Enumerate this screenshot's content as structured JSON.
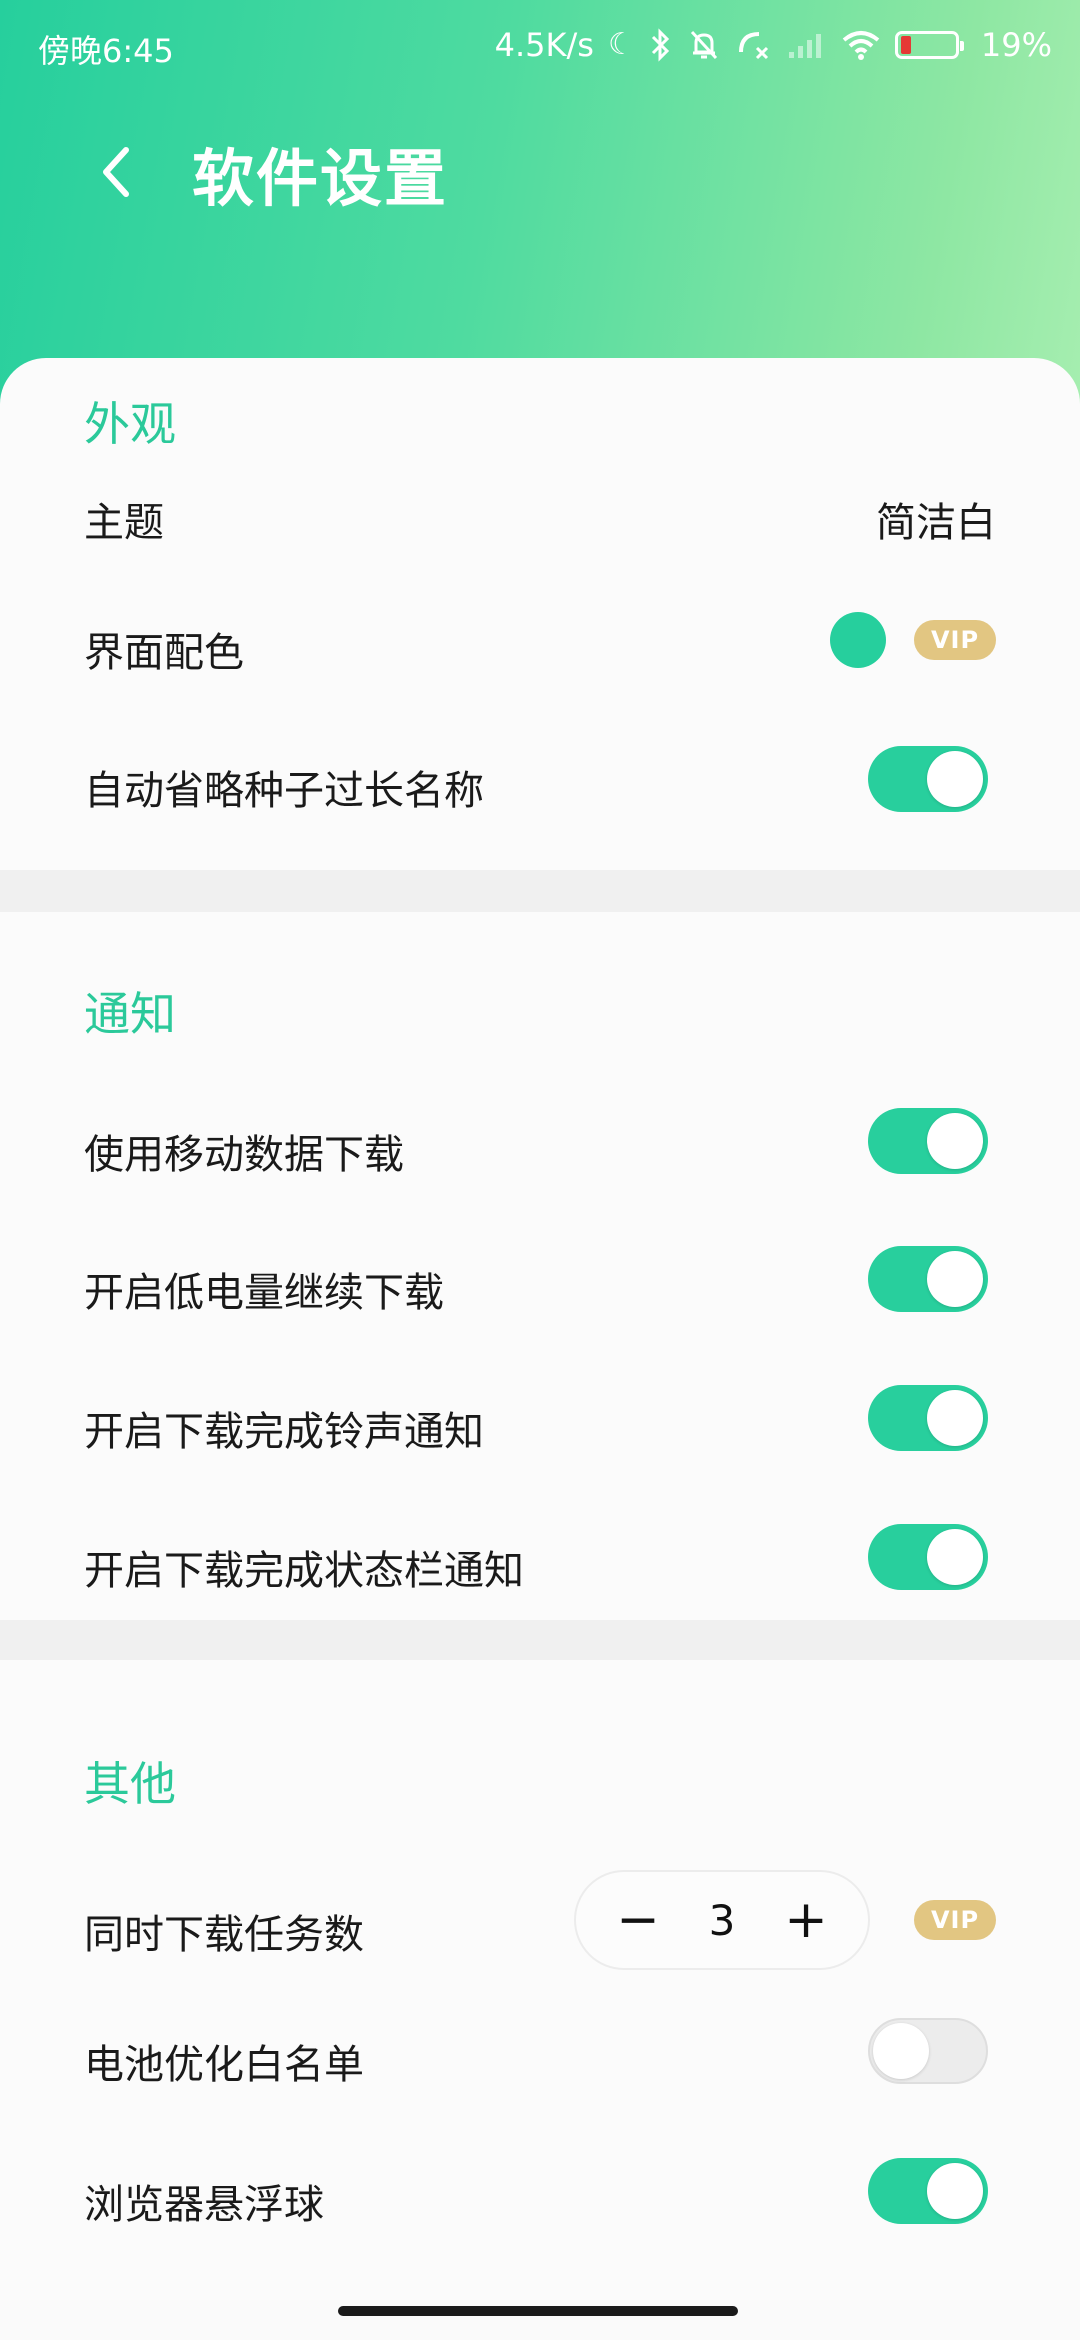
{
  "status": {
    "time": "傍晚6:45",
    "speed": "4.5K/s",
    "battery": "19%",
    "battery_level": 0.19
  },
  "header": {
    "title": "软件设置",
    "back_icon": "back-arrow-icon"
  },
  "colors": {
    "accent": "#28cf9d",
    "vip": "#e2c682"
  },
  "sections": {
    "appearance": {
      "title": "外观",
      "theme_label": "主题",
      "theme_value": "简洁白",
      "color_label": "界面配色",
      "color_value": "#26cf9d",
      "color_vip": "VIP",
      "truncate_label": "自动省略种子过长名称",
      "truncate_on": true
    },
    "notify": {
      "title": "通知",
      "mobile_data_label": "使用移动数据下载",
      "mobile_data_on": true,
      "low_battery_label": "开启低电量继续下载",
      "low_battery_on": true,
      "ringtone_label": "开启下载完成铃声通知",
      "ringtone_on": true,
      "statusbar_label": "开启下载完成状态栏通知",
      "statusbar_on": true
    },
    "other": {
      "title": "其他",
      "concurrent_label": "同时下载任务数",
      "concurrent_value": "3",
      "minus": "−",
      "plus": "+",
      "concurrent_vip": "VIP",
      "battery_whitelist_label": "电池优化白名单",
      "battery_whitelist_on": false,
      "floating_ball_label": "浏览器悬浮球",
      "floating_ball_on": true
    }
  }
}
